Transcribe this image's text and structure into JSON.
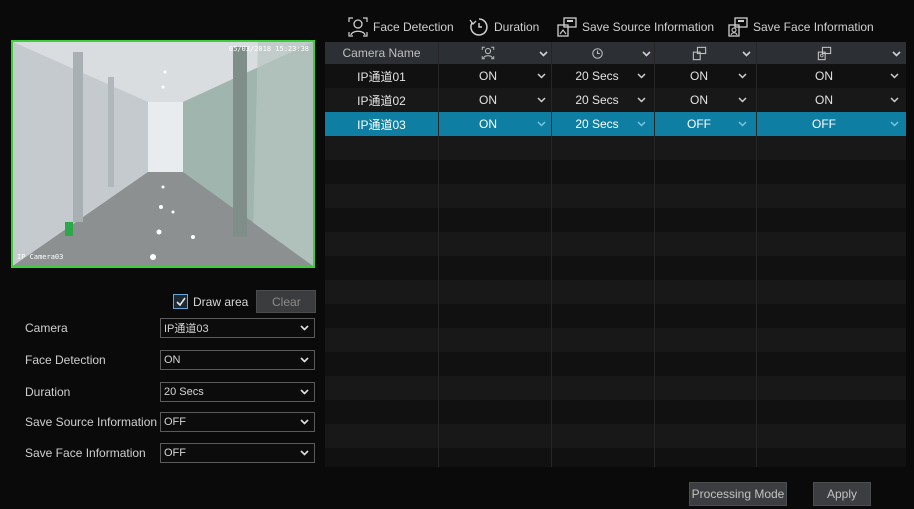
{
  "legend": {
    "face_detection": "Face Detection",
    "duration": "Duration",
    "save_source": "Save Source Information",
    "save_face": "Save Face Information"
  },
  "preview": {
    "timestamp": "05/03/2018 15:23:38",
    "camera_label": "IP Camera03"
  },
  "draw_area": {
    "label": "Draw area",
    "checked": true,
    "clear_label": "Clear"
  },
  "form": {
    "camera": {
      "label": "Camera",
      "value": "IP通道03"
    },
    "face_detection": {
      "label": "Face Detection",
      "value": "ON"
    },
    "duration": {
      "label": "Duration",
      "value": "20 Secs"
    },
    "save_source": {
      "label": "Save Source Information",
      "value": "OFF"
    },
    "save_face": {
      "label": "Save Face Information",
      "value": "OFF"
    }
  },
  "table": {
    "header": {
      "camera_name": "Camera Name",
      "face_icon": "face-detection-icon",
      "duration_icon": "duration-icon",
      "source_icon": "save-source-icon",
      "face_save_icon": "save-face-icon"
    },
    "rows": [
      {
        "camera": "IP通道01",
        "face": "ON",
        "duration": "20 Secs",
        "source": "ON",
        "save_face": "ON"
      },
      {
        "camera": "IP通道02",
        "face": "ON",
        "duration": "20 Secs",
        "source": "ON",
        "save_face": "ON"
      },
      {
        "camera": "IP通道03",
        "face": "ON",
        "duration": "20 Secs",
        "source": "OFF",
        "save_face": "OFF"
      }
    ],
    "selected_index": 2
  },
  "buttons": {
    "processing_mode": "Processing Mode",
    "apply": "Apply"
  },
  "colors": {
    "selected_row": "#0e7fa3",
    "preview_border": "#3ccf3c",
    "checkbox_accent": "#5fa8d8"
  }
}
